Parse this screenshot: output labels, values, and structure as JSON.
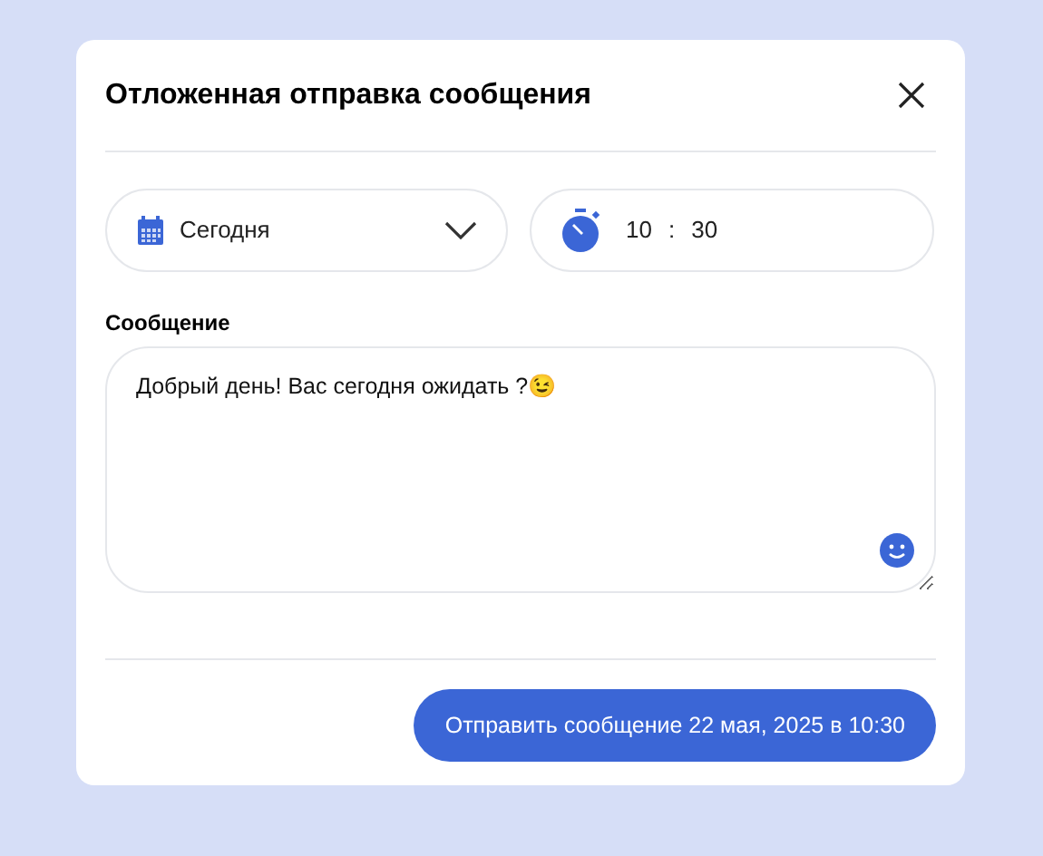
{
  "dialog": {
    "title": "Отложенная отправка сообщения"
  },
  "date": {
    "value": "Сегодня"
  },
  "time": {
    "hours": "10",
    "separator": ":",
    "minutes": "30"
  },
  "message": {
    "label": "Сообщение",
    "value": "Добрый день! Вас сегодня ожидать ?😉"
  },
  "submit": {
    "label": "Отправить сообщение 22 мая, 2025 в 10:30"
  }
}
